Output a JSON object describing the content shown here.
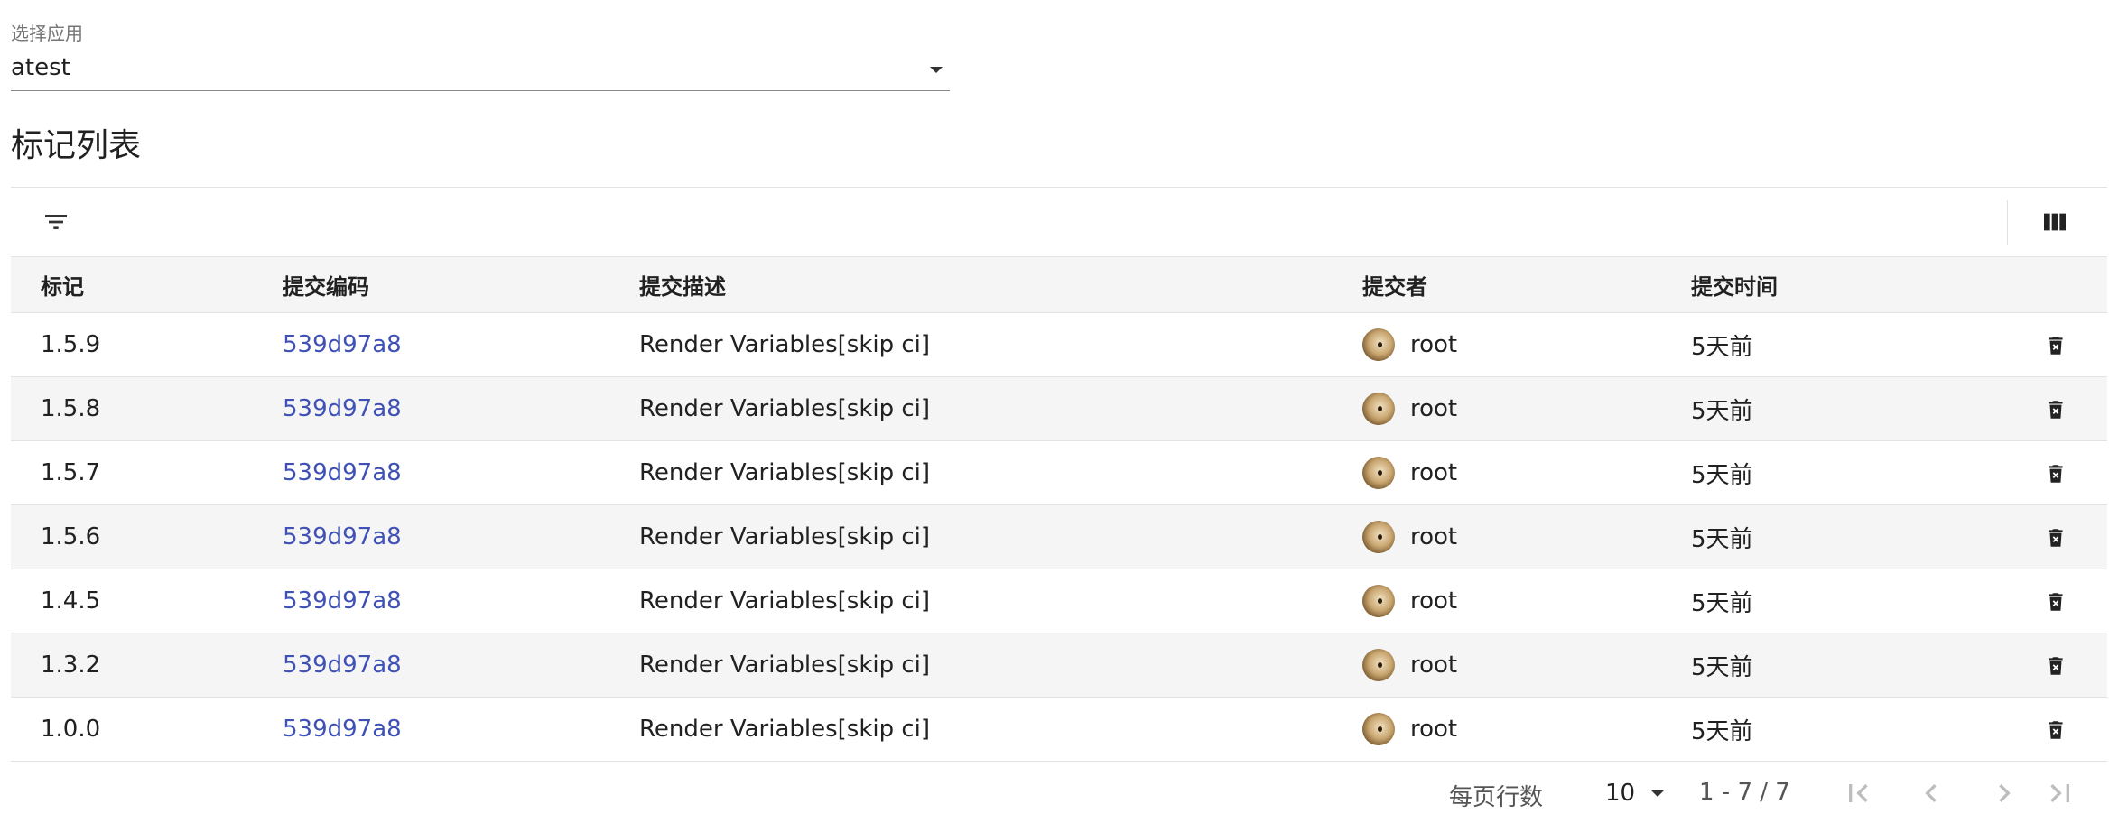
{
  "select": {
    "label": "选择应用",
    "value": "atest"
  },
  "title": "标记列表",
  "toolbar": {
    "filter_icon": "filter-icon",
    "columns_icon": "view-column-icon"
  },
  "table": {
    "headers": [
      "标记",
      "提交编码",
      "提交描述",
      "提交者",
      "提交时间"
    ],
    "rows": [
      {
        "tag": "1.5.9",
        "commit": "539d97a8",
        "description": "Render Variables[skip ci]",
        "author": "root",
        "time": "5天前"
      },
      {
        "tag": "1.5.8",
        "commit": "539d97a8",
        "description": "Render Variables[skip ci]",
        "author": "root",
        "time": "5天前"
      },
      {
        "tag": "1.5.7",
        "commit": "539d97a8",
        "description": "Render Variables[skip ci]",
        "author": "root",
        "time": "5天前"
      },
      {
        "tag": "1.5.6",
        "commit": "539d97a8",
        "description": "Render Variables[skip ci]",
        "author": "root",
        "time": "5天前"
      },
      {
        "tag": "1.4.5",
        "commit": "539d97a8",
        "description": "Render Variables[skip ci]",
        "author": "root",
        "time": "5天前"
      },
      {
        "tag": "1.3.2",
        "commit": "539d97a8",
        "description": "Render Variables[skip ci]",
        "author": "root",
        "time": "5天前"
      },
      {
        "tag": "1.0.0",
        "commit": "539d97a8",
        "description": "Render Variables[skip ci]",
        "author": "root",
        "time": "5天前"
      }
    ]
  },
  "pagination": {
    "rows_per_page_label": "每页行数",
    "rows_per_page": "10",
    "range": "1 - 7 / 7"
  },
  "colors": {
    "link": "#3f51b5",
    "header_bg": "#f5f5f5",
    "stripe_bg": "#f5f5f5"
  }
}
